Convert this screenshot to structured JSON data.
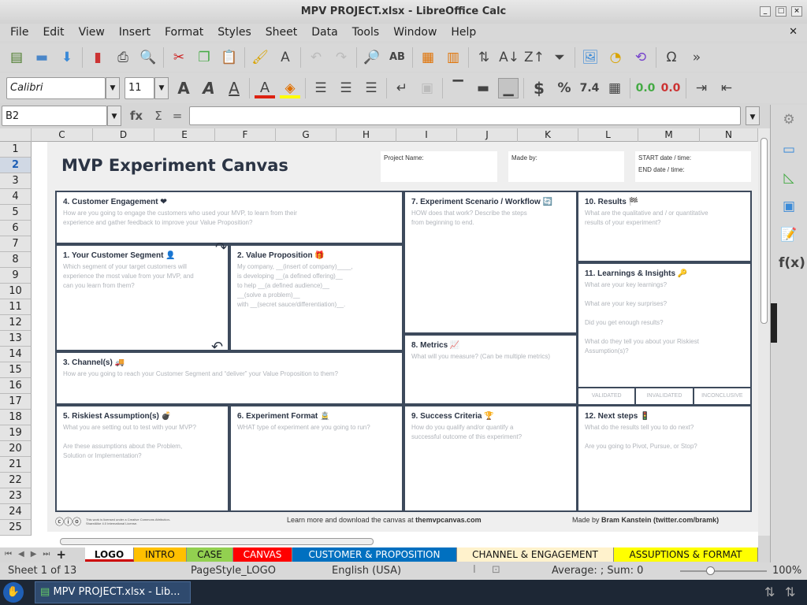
{
  "window": {
    "title": "MPV  PROJECT.xlsx - LibreOffice Calc"
  },
  "menu": [
    "File",
    "Edit",
    "View",
    "Insert",
    "Format",
    "Styles",
    "Sheet",
    "Data",
    "Tools",
    "Window",
    "Help"
  ],
  "toolbar": {
    "font": "Calibri",
    "size": "11"
  },
  "formula": {
    "cell": "B2",
    "fx": "fx",
    "sum": "Σ",
    "eq": "=",
    "value": ""
  },
  "columns": [
    "C",
    "D",
    "E",
    "F",
    "G",
    "H",
    "I",
    "J",
    "K",
    "L",
    "M",
    "N"
  ],
  "rows": [
    "1",
    "2",
    "3",
    "4",
    "5",
    "6",
    "7",
    "8",
    "9",
    "10",
    "11",
    "12",
    "13",
    "14",
    "15",
    "16",
    "17",
    "18",
    "19",
    "20",
    "21",
    "22",
    "23",
    "24",
    "25"
  ],
  "canvas": {
    "title": "MVP Experiment Canvas",
    "project_name": "Project Name:",
    "made_by": "Made by:",
    "start": "START date / time:",
    "end": "END date / time:",
    "boxes": [
      {
        "title": "4. Customer Engagement ❤",
        "body": "How are you going to engage the customers who used your MVP, to learn from their\nexperience and gather feedback to improve your Value Proposition?"
      },
      {
        "title": "1. Your Customer Segment 👤",
        "body": "Which segment of your target customers will\nexperience the most value from your MVP, and\ncan you learn from them?"
      },
      {
        "title": "2. Value Proposition 🎁",
        "body": "My company, __(insert of company)____,\nis developing __(a defined offering)__\nto help __(a defined audience)__\n__(solve a problem)__\nwith __(secret sauce/differentiation)__."
      },
      {
        "title": "3. Channel(s) 🚚",
        "body": "How are you going to reach your Customer Segment and “deliver” your Value Proposition to them?"
      },
      {
        "title": "7. Experiment Scenario / Workflow 🔄",
        "body": "HOW does that work? Describe the steps\nfrom beginning to end."
      },
      {
        "title": "8. Metrics 📈",
        "body": "What will you measure? (Can be multiple metrics)"
      },
      {
        "title": "10. Results 🏁",
        "body": "What are the qualitative and / or quantitative\nresults of your experiment?"
      },
      {
        "title": "11. Learnings & Insights 🔑",
        "body": "What are your key learnings?\n\nWhat are your key surprises?\n\nDid you get enough results?\n\nWhat do they tell you about your Riskiest\nAssumption(s)?"
      },
      {
        "title": "5. Riskiest Assumption(s) 💣",
        "body": "What you are setting out to test with your MVP?\n\nAre these assumptions about the Problem,\nSolution or Implementation?"
      },
      {
        "title": "6. Experiment Format 🚊",
        "body": "WHAT type of experiment are you going to run?"
      },
      {
        "title": "9. Success Criteria 🏆",
        "body": "How do you qualify and/or quantify a\nsuccessful outcome of this experiment?"
      },
      {
        "title": "12. Next steps 🚦",
        "body": "What do the results tell you to do next?\n\nAre you going to Pivot, Pursue, or Stop?"
      }
    ],
    "outcomes": [
      "VALIDATED",
      "INVALIDATED",
      "INCONCLUSIVE"
    ],
    "license": "This work is licensed under a Creative Commons Attribution-ShareAlike 4.0 International License.",
    "footer_mid": "Learn more and download the canvas at ",
    "footer_site": "themvpcanvas.com",
    "footer_made": "Made by ",
    "footer_author": "Bram Kanstein (twitter.com/bramk)"
  },
  "sheet_tabs": [
    {
      "label": "LOGO",
      "color": "#ffffff"
    },
    {
      "label": "INTRO",
      "color": "#ffc000"
    },
    {
      "label": "CASE",
      "color": "#92d050"
    },
    {
      "label": "CANVAS",
      "color": "#ff0000"
    },
    {
      "label": "CUSTOMER & PROPOSITION",
      "color": "#0070c0"
    },
    {
      "label": "CHANNEL & ENGAGEMENT",
      "color": "#fff2cc"
    },
    {
      "label": "ASSUPTIONS & FORMAT",
      "color": "#ffff00"
    }
  ],
  "status": {
    "sheet": "Sheet 1 of 13",
    "style": "PageStyle_LOGO",
    "lang": "English (USA)",
    "sum": "Average: ; Sum: 0",
    "zoom": "100%"
  },
  "taskbar": {
    "app": "MPV  PROJECT.xlsx - Lib..."
  }
}
